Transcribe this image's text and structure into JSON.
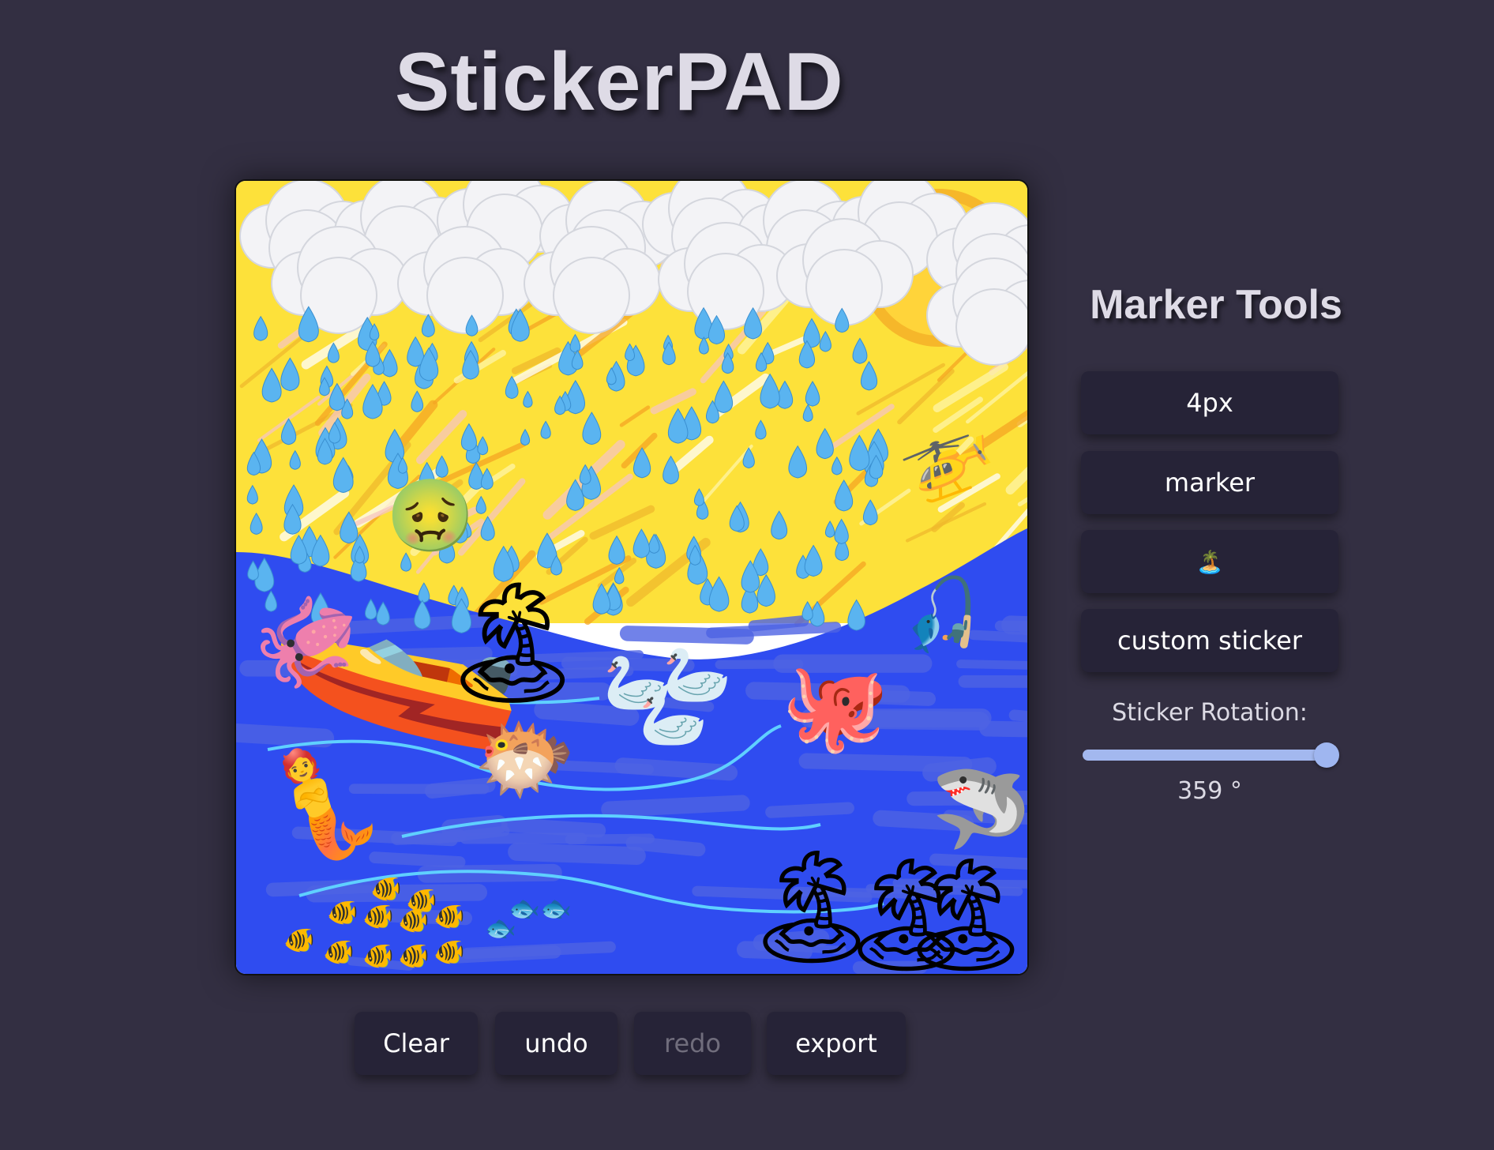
{
  "app": {
    "title": "StickerPAD"
  },
  "sidebar": {
    "title": "Marker Tools",
    "size_label": "4px",
    "mode_label": "marker",
    "sticker_label": "🏝️",
    "custom_sticker_label": "custom sticker",
    "rotation_label": "Sticker Rotation:",
    "rotation_value": "359 °",
    "rotation_fraction": 0.997
  },
  "toolbar": {
    "clear_label": "Clear",
    "undo_label": "undo",
    "redo_label": "redo",
    "export_label": "export"
  },
  "canvas": {
    "sky_color": "#fde13a",
    "sea_color": "#2f4cf0",
    "sea_light_color": "#4e63e4",
    "stickers": [
      {
        "name": "cloud-sticker",
        "glyph": "☁"
      },
      {
        "name": "sun-sticker",
        "glyph": "☀"
      },
      {
        "name": "droplet-sticker",
        "glyph": "💧"
      },
      {
        "name": "boat-sticker",
        "glyph": "🚤"
      },
      {
        "name": "sick-captain-sticker",
        "glyph": "🤢"
      },
      {
        "name": "helicopter-sticker",
        "glyph": "🚁"
      },
      {
        "name": "squid-sticker",
        "glyph": "🦑"
      },
      {
        "name": "island-sticker",
        "glyph": "🏝"
      },
      {
        "name": "swan-sticker",
        "glyph": "🦢"
      },
      {
        "name": "octopus-sticker",
        "glyph": "🐙"
      },
      {
        "name": "blowfish-sticker",
        "glyph": "🐡"
      },
      {
        "name": "mermaid-sticker",
        "glyph": "🧜"
      },
      {
        "name": "shark-sticker",
        "glyph": "🦈"
      },
      {
        "name": "tropical-fish-sticker",
        "glyph": "🐠"
      },
      {
        "name": "fish-sticker",
        "glyph": "🐟"
      },
      {
        "name": "fishing-rowboat-sticker",
        "glyph": "🎣"
      }
    ]
  }
}
